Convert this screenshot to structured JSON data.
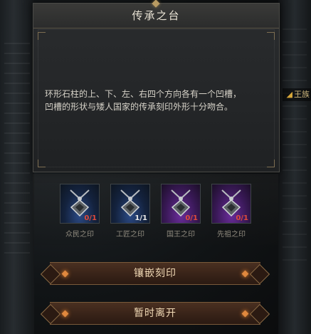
{
  "dialog": {
    "title": "传承之台",
    "description_lines": [
      "环形石柱的上、下、左、右四个方向各有一个凹槽，",
      "凹槽的形状与矮人国家的传承刻印外形十分吻合。"
    ]
  },
  "background": {
    "side_tag": "王族"
  },
  "slots": [
    {
      "label": "众民之印",
      "count": "0/1",
      "rarity": "blue",
      "rarity_color": "#2b4a86"
    },
    {
      "label": "工匠之印",
      "count": "1/1",
      "rarity": "blue",
      "rarity_color": "#2b4a86"
    },
    {
      "label": "国王之印",
      "count": "0/1",
      "rarity": "purple",
      "rarity_color": "#6a2c9a"
    },
    {
      "label": "先祖之印",
      "count": "0/1",
      "rarity": "purple",
      "rarity_color": "#6a2c9a"
    }
  ],
  "actions": {
    "inlay_label": "镶嵌刻印",
    "leave_label": "暂时离开"
  },
  "colors": {
    "count_empty": "#e04a3c",
    "count_full": "#e8e8e8",
    "button_gem": "#e0883e",
    "title_text": "#e8e2d4"
  },
  "icons": {
    "slot_item": "seal-pendant-icon",
    "button_ornament": "diamond-gem-icon"
  }
}
